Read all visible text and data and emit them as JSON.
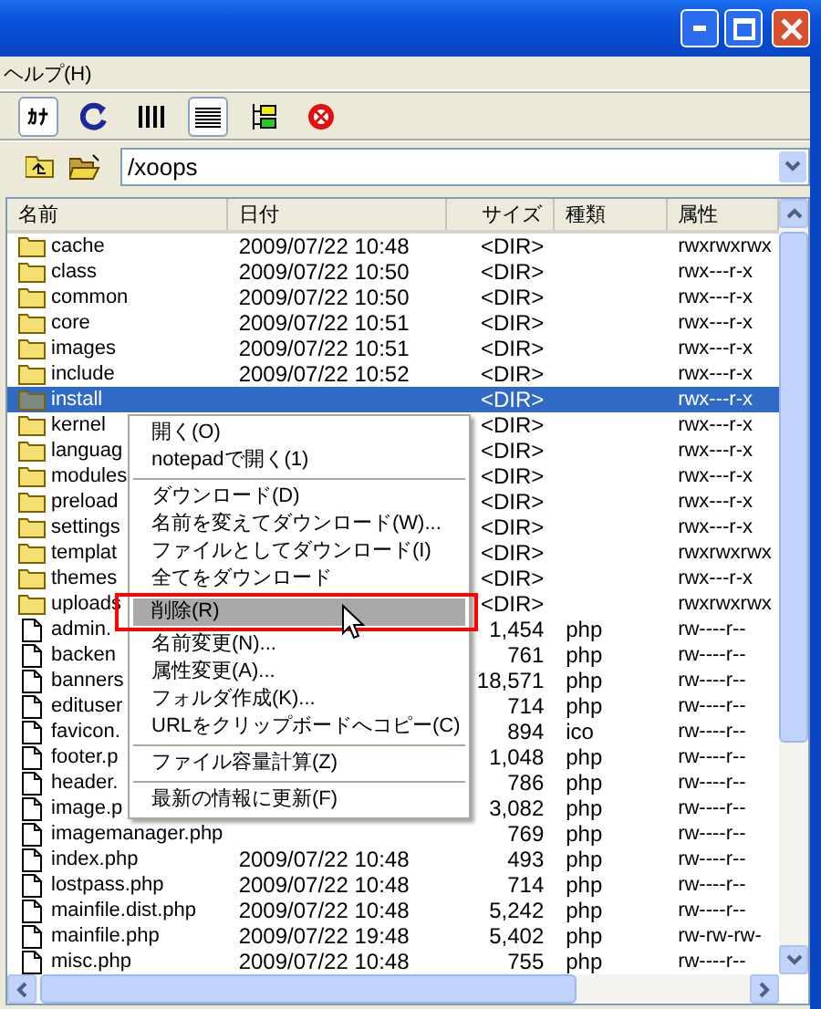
{
  "menu_bar": [
    {
      "label": "ヘルプ(H)"
    }
  ],
  "toolbar": [
    {
      "kind": "kana",
      "label": "ｶﾅ",
      "pressed": true
    },
    {
      "kind": "refresh",
      "pressed": false
    },
    {
      "kind": "list",
      "pressed": false
    },
    {
      "kind": "details",
      "pressed": true
    },
    {
      "kind": "tree",
      "pressed": false
    },
    {
      "kind": "stop",
      "pressed": false
    }
  ],
  "address": {
    "value": "/xoops"
  },
  "table": {
    "columns": [
      "名前",
      "日付",
      "サイズ",
      "種類",
      "属性"
    ],
    "rows": [
      {
        "kind": "dir",
        "name": "cache",
        "date": "2009/07/22 10:48",
        "size": "<DIR>",
        "attr": "rwxrwxrwx",
        "selected": false
      },
      {
        "kind": "dir",
        "name": "class",
        "date": "2009/07/22 10:50",
        "size": "<DIR>",
        "attr": "rwx---r-x",
        "selected": false
      },
      {
        "kind": "dir",
        "name": "common",
        "date": "2009/07/22 10:50",
        "size": "<DIR>",
        "attr": "rwx---r-x",
        "selected": false
      },
      {
        "kind": "dir",
        "name": "core",
        "date": "2009/07/22 10:51",
        "size": "<DIR>",
        "attr": "rwx---r-x",
        "selected": false
      },
      {
        "kind": "dir",
        "name": "images",
        "date": "2009/07/22 10:51",
        "size": "<DIR>",
        "attr": "rwx---r-x",
        "selected": false
      },
      {
        "kind": "dir",
        "name": "include",
        "date": "2009/07/22 10:52",
        "size": "<DIR>",
        "attr": "rwx---r-x",
        "selected": false
      },
      {
        "kind": "dir",
        "name": "install",
        "size": "<DIR>",
        "attr": "rwx---r-x",
        "selected": true
      },
      {
        "kind": "dir",
        "name": "kernel",
        "size": "<DIR>",
        "attr": "rwx---r-x",
        "selected": false
      },
      {
        "kind": "dir",
        "name": "languag",
        "size": "<DIR>",
        "attr": "rwx---r-x",
        "selected": false
      },
      {
        "kind": "dir",
        "name": "modules",
        "size": "<DIR>",
        "attr": "rwx---r-x",
        "selected": false
      },
      {
        "kind": "dir",
        "name": "preload",
        "size": "<DIR>",
        "attr": "rwx---r-x",
        "selected": false
      },
      {
        "kind": "dir",
        "name": "settings",
        "size": "<DIR>",
        "attr": "rwx---r-x",
        "selected": false
      },
      {
        "kind": "dir",
        "name": "templat",
        "size": "<DIR>",
        "attr": "rwxrwxrwx",
        "selected": false
      },
      {
        "kind": "dir",
        "name": "themes",
        "size": "<DIR>",
        "attr": "rwx---r-x",
        "selected": false
      },
      {
        "kind": "dir",
        "name": "uploads",
        "size": "<DIR>",
        "attr": "rwxrwxrwx",
        "selected": false
      },
      {
        "kind": "file",
        "name": "admin.",
        "size": "1,454",
        "type": "php",
        "attr": "rw----r--",
        "selected": false
      },
      {
        "kind": "file",
        "name": "backen",
        "size": "761",
        "type": "php",
        "attr": "rw----r--",
        "selected": false
      },
      {
        "kind": "file",
        "name": "banners",
        "size": "18,571",
        "type": "php",
        "attr": "rw----r--",
        "selected": false
      },
      {
        "kind": "file",
        "name": "edituser",
        "size": "714",
        "type": "php",
        "attr": "rw----r--",
        "selected": false
      },
      {
        "kind": "file",
        "name": "favicon.",
        "size": "894",
        "type": "ico",
        "attr": "rw----r--",
        "selected": false
      },
      {
        "kind": "file",
        "name": "footer.p",
        "size": "1,048",
        "type": "php",
        "attr": "rw----r--",
        "selected": false
      },
      {
        "kind": "file",
        "name": "header.",
        "size": "786",
        "type": "php",
        "attr": "rw----r--",
        "selected": false
      },
      {
        "kind": "file",
        "name": "image.p",
        "size": "3,082",
        "type": "php",
        "attr": "rw----r--",
        "selected": false
      },
      {
        "kind": "file",
        "name": "imagemanager.php",
        "size": "769",
        "type": "php",
        "attr": "rw----r--",
        "selected": false
      },
      {
        "kind": "file",
        "name": "index.php",
        "date": "2009/07/22 10:48",
        "size": "493",
        "type": "php",
        "attr": "rw----r--",
        "selected": false
      },
      {
        "kind": "file",
        "name": "lostpass.php",
        "date": "2009/07/22 10:48",
        "size": "714",
        "type": "php",
        "attr": "rw----r--",
        "selected": false
      },
      {
        "kind": "file",
        "name": "mainfile.dist.php",
        "date": "2009/07/22 10:48",
        "size": "5,242",
        "type": "php",
        "attr": "rw----r--",
        "selected": false
      },
      {
        "kind": "file",
        "name": "mainfile.php",
        "date": "2009/07/22 19:48",
        "size": "5,402",
        "type": "php",
        "attr": "rw-rw-rw-",
        "selected": false
      },
      {
        "kind": "file",
        "name": "misc.php",
        "date": "2009/07/22 10:48",
        "size": "755",
        "type": "php",
        "attr": "rw----r--",
        "selected": false
      }
    ]
  },
  "context_menu": [
    {
      "kind": "item",
      "label": "開く(O)",
      "selected": false
    },
    {
      "kind": "item",
      "label": "notepadで開く(1)",
      "selected": false
    },
    {
      "kind": "separator"
    },
    {
      "kind": "item",
      "label": "ダウンロード(D)",
      "selected": false
    },
    {
      "kind": "item",
      "label": "名前を変えてダウンロード(W)...",
      "selected": false
    },
    {
      "kind": "item",
      "label": "ファイルとしてダウンロード(I)",
      "selected": false
    },
    {
      "kind": "item",
      "label": "全てをダウンロード",
      "selected": false
    },
    {
      "kind": "item",
      "label": "削除(R)",
      "selected": true
    },
    {
      "kind": "item",
      "label": "名前変更(N)...",
      "selected": false
    },
    {
      "kind": "item",
      "label": "属性変更(A)...",
      "selected": false
    },
    {
      "kind": "item",
      "label": "フォルダ作成(K)...",
      "selected": false
    },
    {
      "kind": "item",
      "label": "URLをクリップボードへコピー(C)",
      "selected": false
    },
    {
      "kind": "separator"
    },
    {
      "kind": "item",
      "label": "ファイル容量計算(Z)",
      "selected": false
    },
    {
      "kind": "separator"
    },
    {
      "kind": "item",
      "label": "最新の情報に更新(F)",
      "selected": false
    }
  ]
}
